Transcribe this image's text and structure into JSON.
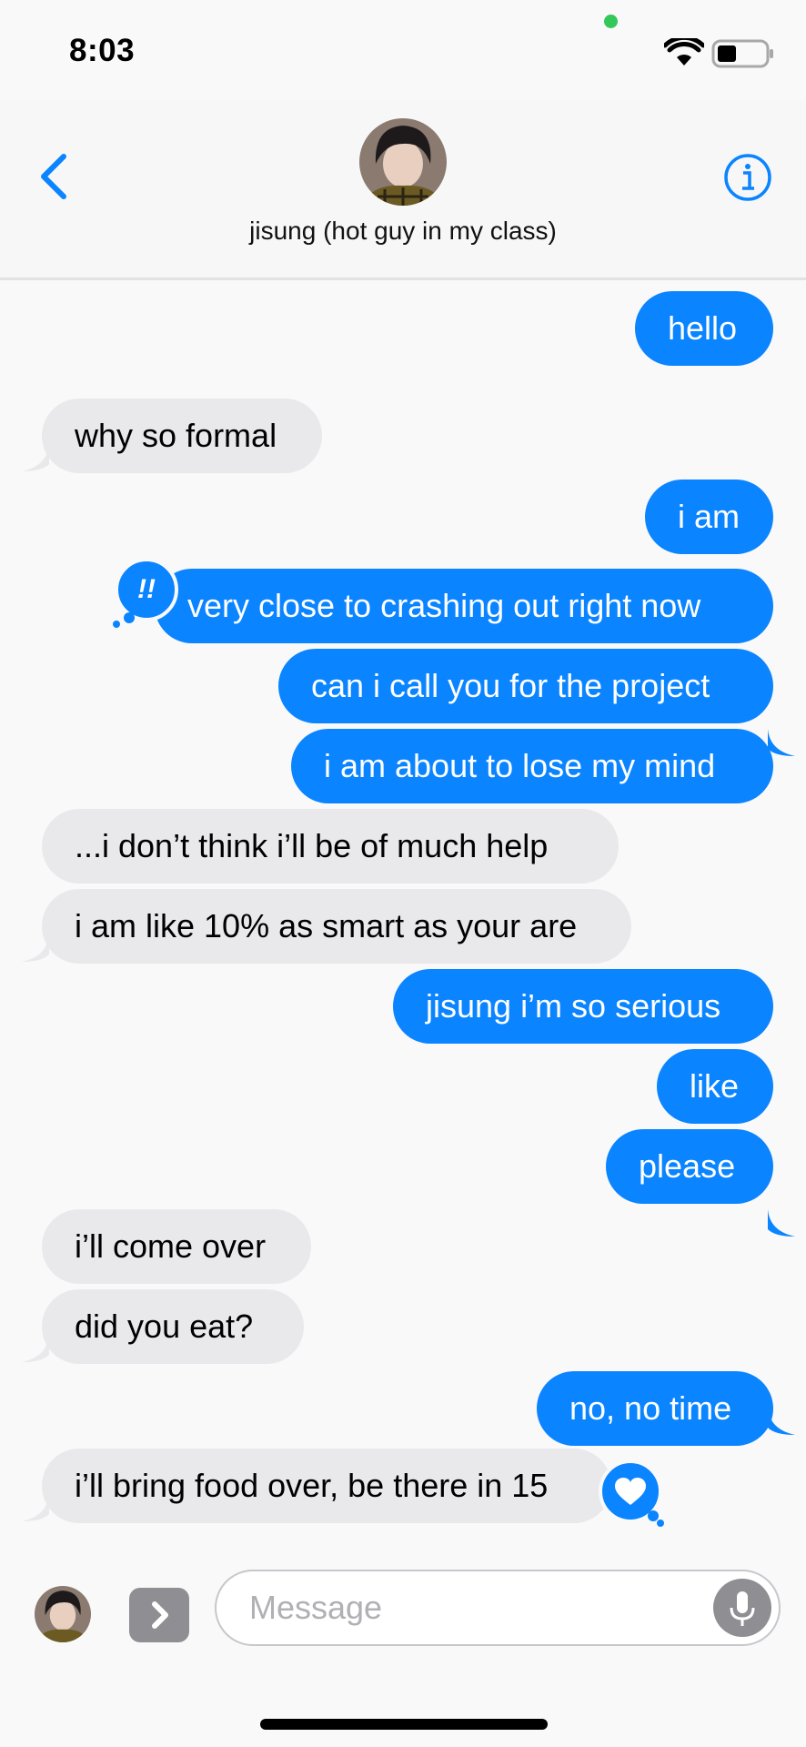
{
  "status_bar": {
    "time": "8:03"
  },
  "header": {
    "contact_name": "jisung (hot guy in my class)"
  },
  "messages": [
    {
      "text": "hello"
    },
    {
      "text": "why so formal"
    },
    {
      "text": "i am"
    },
    {
      "text": "very close to crashing out right now",
      "tapback": "!!"
    },
    {
      "text": "can i call you for the project"
    },
    {
      "text": "i am about to lose my mind"
    },
    {
      "text": "...i don’t think i’ll be of much help"
    },
    {
      "text": "i am like 10% as smart as your are"
    },
    {
      "text": "jisung i’m so serious"
    },
    {
      "text": "like"
    },
    {
      "text": "please"
    },
    {
      "text": "i’ll come over"
    },
    {
      "text": "did you eat?"
    },
    {
      "text": "no, no time"
    },
    {
      "text": "i’ll bring food over, be there in 15",
      "tapback": "heart"
    }
  ],
  "input": {
    "placeholder": "Message"
  },
  "colors": {
    "sent": "#0a84ff",
    "received": "#e9e9eb",
    "accent": "#0a84ff"
  },
  "icons": [
    "back-chevron-icon",
    "info-icon",
    "wifi-icon",
    "battery-icon",
    "apps-chevron-icon",
    "microphone-icon",
    "heart-icon"
  ]
}
